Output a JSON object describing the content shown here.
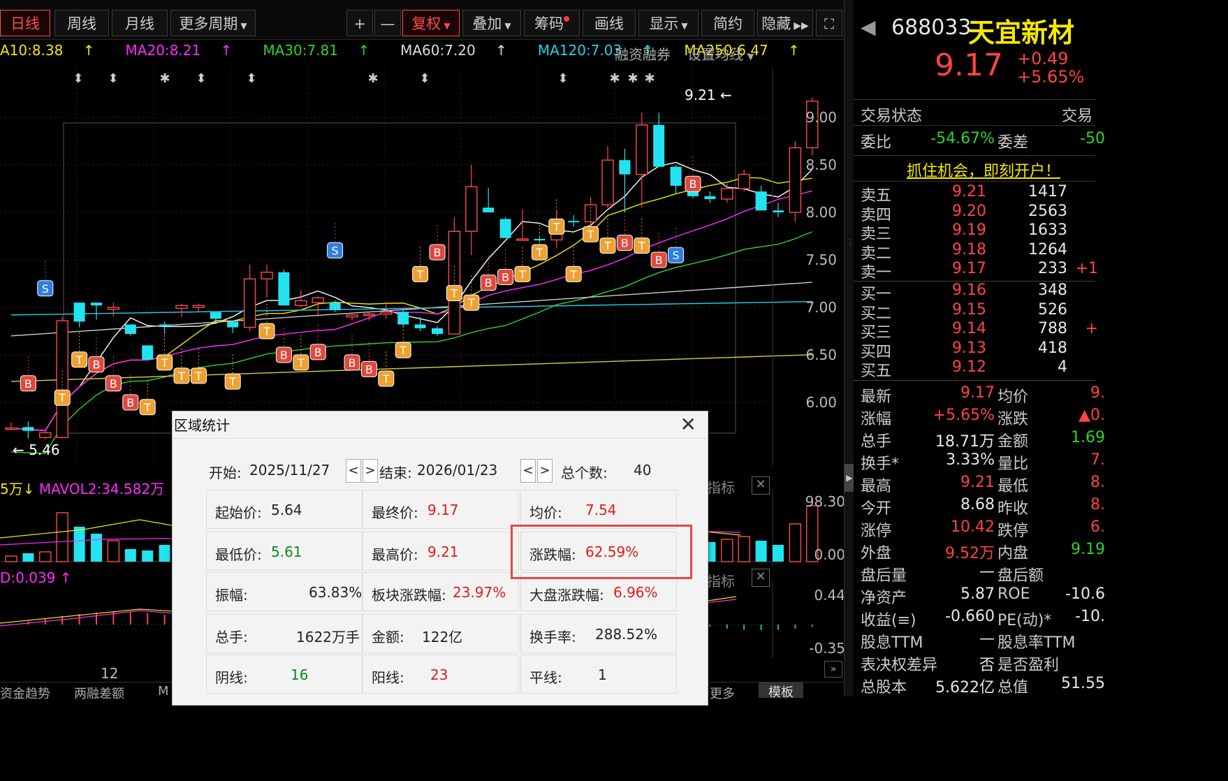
{
  "toolbar": {
    "periods": [
      {
        "label": "日线",
        "active": true
      },
      {
        "label": "周线",
        "active": false
      },
      {
        "label": "月线",
        "active": false
      },
      {
        "label": "更多周期",
        "active": false
      }
    ],
    "right_buttons": [
      "+",
      "—",
      "复权",
      "叠加",
      "筹码",
      "画线",
      "显示",
      "简约",
      "隐藏"
    ]
  },
  "ma_line": [
    {
      "text": "A10:8.38",
      "color": "#f4e800"
    },
    {
      "text": "MA20:8.21",
      "color": "#ff2bff"
    },
    {
      "text": "MA30:7.81",
      "color": "#2bd42b"
    },
    {
      "text": "MA60:7.20",
      "color": "#dddddd"
    },
    {
      "text": "MA120:7.03",
      "color": "#22d3ee"
    },
    {
      "text": "MA250:6.47",
      "color": "#f4e800"
    }
  ],
  "ma_right": {
    "margin": "融资融券",
    "set": "设置均线"
  },
  "price_axis": [
    "9.00",
    "8.50",
    "8.00",
    "7.50",
    "7.00",
    "6.50",
    "6.00"
  ],
  "price_labels": {
    "high": "9.21",
    "low": "5.46"
  },
  "volume_line": {
    "left": "5万",
    "mavol2": "MAVOL2:34.582万"
  },
  "volume_axis": [
    "98.30",
    "0.00"
  ],
  "macd_line": {
    "left": "D:0.039"
  },
  "macd_axis": [
    "0.44",
    "-0.35"
  ],
  "indicator_label": "指标",
  "bottom_tabs": [
    "资金趋势",
    "两融差额",
    "M"
  ],
  "bottom_right_tabs": [
    "更多",
    "模板"
  ],
  "x_label": "12",
  "stock": {
    "code": "688033",
    "name": "天宜新材",
    "price": "9.17",
    "change": "+0.49",
    "change_pct": "+5.65%"
  },
  "trade_status": {
    "label": "交易状态",
    "right": "交易"
  },
  "ratio": {
    "k1": "委比",
    "v1": "-54.67%",
    "k2": "委差",
    "v2": "-50"
  },
  "promo": "抓住机会，即刻开户！",
  "asks": [
    {
      "label": "卖五",
      "price": "9.21",
      "vol": "1417"
    },
    {
      "label": "卖四",
      "price": "9.20",
      "vol": "2563"
    },
    {
      "label": "卖三",
      "price": "9.19",
      "vol": "1633"
    },
    {
      "label": "卖二",
      "price": "9.18",
      "vol": "1264"
    },
    {
      "label": "卖一",
      "price": "9.17",
      "vol": "233",
      "extra": "+1"
    }
  ],
  "bids": [
    {
      "label": "买一",
      "price": "9.16",
      "vol": "348"
    },
    {
      "label": "买二",
      "price": "9.15",
      "vol": "526"
    },
    {
      "label": "买三",
      "price": "9.14",
      "vol": "788",
      "extra": "+"
    },
    {
      "label": "买四",
      "price": "9.13",
      "vol": "418"
    },
    {
      "label": "买五",
      "price": "9.12",
      "vol": "4"
    }
  ],
  "quotes": [
    {
      "k1": "最新",
      "v1": "9.17",
      "c1": "red",
      "k2": "均价",
      "v2": "9."
    },
    {
      "k1": "涨幅",
      "v1": "+5.65%",
      "c1": "red",
      "k2": "涨跌",
      "v2": "▲0."
    },
    {
      "k1": "总手",
      "v1": "18.71万",
      "c1": "white",
      "k2": "金额",
      "v2": "1.69"
    },
    {
      "k1": "换手*",
      "v1": "3.33%",
      "c1": "white",
      "k2": "量比",
      "v2": "7."
    },
    {
      "k1": "最高",
      "v1": "9.21",
      "c1": "red",
      "k2": "最低",
      "v2": "8."
    },
    {
      "k1": "今开",
      "v1": "8.68",
      "c1": "white",
      "k2": "昨收",
      "v2": "8."
    },
    {
      "k1": "涨停",
      "v1": "10.42",
      "c1": "red",
      "k2": "跌停",
      "v2": "6."
    },
    {
      "k1": "外盘",
      "v1": "9.52万",
      "c1": "red",
      "k2": "内盘",
      "v2": "9.19"
    },
    {
      "k1": "盘后量",
      "v1": "—",
      "c1": "white",
      "k2": "盘后额",
      "v2": ""
    },
    {
      "k1": "净资产",
      "v1": "5.87",
      "c1": "white",
      "k2": "ROE",
      "v2": "-10.6"
    },
    {
      "k1": "收益(≡)",
      "v1": "-0.660",
      "c1": "white",
      "k2": "PE(动)*",
      "v2": "-10."
    },
    {
      "k1": "股息TTM",
      "v1": "—",
      "c1": "white",
      "k2": "股息率TTM",
      "v2": ""
    },
    {
      "k1": "表决权差异",
      "v1": "否",
      "c1": "white",
      "k2": "是否盈利",
      "v2": ""
    },
    {
      "k1": "总股本",
      "v1": "5.622亿",
      "c1": "white",
      "k2": "总值",
      "v2": "51.55"
    }
  ],
  "dialog": {
    "title": "区域统计",
    "start_label": "开始:",
    "start_date": "2025/11/27",
    "end_label": "结束:",
    "end_date": "2026/01/23",
    "count_label": "总个数:",
    "count": "40",
    "rows": [
      [
        {
          "k": "起始价:",
          "v": "5.64",
          "c": "dark"
        },
        {
          "k": "最终价:",
          "v": "9.17",
          "c": "red"
        },
        {
          "k": "均价:",
          "v": "7.54",
          "c": "red"
        }
      ],
      [
        {
          "k": "最低价:",
          "v": "5.61",
          "c": "green"
        },
        {
          "k": "最高价:",
          "v": "9.21",
          "c": "red"
        },
        {
          "k": "涨跌幅:",
          "v": "62.59%",
          "c": "red"
        }
      ],
      [
        {
          "k": "振幅:",
          "v": "63.83%",
          "c": "dark"
        },
        {
          "k": "板块涨跌幅:",
          "v": "23.97%",
          "c": "red"
        },
        {
          "k": "大盘涨跌幅:",
          "v": "6.96%",
          "c": "red"
        }
      ],
      [
        {
          "k": "总手:",
          "v": "1622万手",
          "c": "dark"
        },
        {
          "k": "金额:",
          "v": "122亿",
          "c": "dark"
        },
        {
          "k": "换手率:",
          "v": "288.52%",
          "c": "dark"
        }
      ],
      [
        {
          "k": "阴线:",
          "v": "16",
          "c": "green"
        },
        {
          "k": "阳线:",
          "v": "23",
          "c": "red"
        },
        {
          "k": "平线:",
          "v": "1",
          "c": "dark"
        }
      ]
    ]
  },
  "candles": [
    [
      5.73,
      5.79,
      5.72,
      5.73
    ],
    [
      5.74,
      5.8,
      5.62,
      5.7
    ],
    [
      5.63,
      5.72,
      5.61,
      5.68
    ],
    [
      5.63,
      6.9,
      5.62,
      6.86
    ],
    [
      7.05,
      7.0,
      6.79,
      6.85
    ],
    [
      7.05,
      7.05,
      6.87,
      7.02
    ],
    [
      6.98,
      7.05,
      6.9,
      7.0
    ],
    [
      6.82,
      6.81,
      6.7,
      6.72
    ],
    [
      6.6,
      6.59,
      6.5,
      6.45
    ],
    [
      6.82,
      6.85,
      6.72,
      6.8
    ],
    [
      6.99,
      7.04,
      6.9,
      7.02
    ],
    [
      7.0,
      7.04,
      6.95,
      7.02
    ],
    [
      6.95,
      6.94,
      6.85,
      6.88
    ],
    [
      6.85,
      6.82,
      6.73,
      6.79
    ],
    [
      6.79,
      7.45,
      6.75,
      7.3
    ],
    [
      7.3,
      7.45,
      7.1,
      7.37
    ],
    [
      7.37,
      7.4,
      7.15,
      7.02
    ],
    [
      7.02,
      7.18,
      7.0,
      7.07
    ],
    [
      7.05,
      7.12,
      6.9,
      7.1
    ],
    [
      7.05,
      7.07,
      6.95,
      6.97
    ],
    [
      6.9,
      6.94,
      6.86,
      6.92
    ],
    [
      6.92,
      6.96,
      6.86,
      6.93
    ],
    [
      6.93,
      7.06,
      6.88,
      6.95
    ],
    [
      6.95,
      6.98,
      6.8,
      6.82
    ],
    [
      6.82,
      6.9,
      6.75,
      6.78
    ],
    [
      6.78,
      6.8,
      6.7,
      6.72
    ],
    [
      6.72,
      7.95,
      6.72,
      7.8
    ],
    [
      7.8,
      8.5,
      7.55,
      8.27
    ],
    [
      8.05,
      8.26,
      8.0,
      8.0
    ],
    [
      7.93,
      7.95,
      7.8,
      7.73
    ],
    [
      7.72,
      8.03,
      7.7,
      7.72
    ],
    [
      7.72,
      7.74,
      7.69,
      7.71
    ],
    [
      7.71,
      8.02,
      7.62,
      7.91
    ],
    [
      7.91,
      7.97,
      7.85,
      7.9
    ],
    [
      7.9,
      8.16,
      7.85,
      8.08
    ],
    [
      8.08,
      8.7,
      8.05,
      8.55
    ],
    [
      8.55,
      8.67,
      8.0,
      8.4
    ],
    [
      8.4,
      9.05,
      8.05,
      8.92
    ],
    [
      8.92,
      9.05,
      8.48,
      8.48
    ],
    [
      8.48,
      8.5,
      8.2,
      8.28
    ],
    [
      8.28,
      8.35,
      8.15,
      8.17
    ],
    [
      8.17,
      8.22,
      8.1,
      8.14
    ],
    [
      8.14,
      8.3,
      8.1,
      8.25
    ],
    [
      8.25,
      8.45,
      8.22,
      8.4
    ],
    [
      8.22,
      8.28,
      8.08,
      8.02
    ],
    [
      8.02,
      8.1,
      7.95,
      8.0
    ],
    [
      8.0,
      8.75,
      7.9,
      8.68
    ],
    [
      8.68,
      9.21,
      8.6,
      9.17
    ]
  ],
  "markers": [
    {
      "i": 1,
      "t": "B",
      "p": 6.2
    },
    {
      "i": 2,
      "t": "S",
      "p": 7.2
    },
    {
      "i": 3,
      "t": "T",
      "p": 6.05
    },
    {
      "i": 4,
      "t": "T",
      "p": 6.45
    },
    {
      "i": 5,
      "t": "B",
      "p": 6.4
    },
    {
      "i": 6,
      "t": "B",
      "p": 6.2
    },
    {
      "i": 7,
      "t": "B",
      "p": 6.0
    },
    {
      "i": 8,
      "t": "T",
      "p": 5.95
    },
    {
      "i": 9,
      "t": "T",
      "p": 6.42
    },
    {
      "i": 10,
      "t": "T",
      "p": 6.28
    },
    {
      "i": 11,
      "t": "T",
      "p": 6.28
    },
    {
      "i": 13,
      "t": "T",
      "p": 6.22
    },
    {
      "i": 15,
      "t": "T",
      "p": 6.75
    },
    {
      "i": 16,
      "t": "B",
      "p": 6.5
    },
    {
      "i": 17,
      "t": "T",
      "p": 6.42
    },
    {
      "i": 18,
      "t": "B",
      "p": 6.53
    },
    {
      "i": 19,
      "t": "S",
      "p": 7.6
    },
    {
      "i": 20,
      "t": "B",
      "p": 6.42
    },
    {
      "i": 21,
      "t": "B",
      "p": 6.35
    },
    {
      "i": 22,
      "t": "T",
      "p": 6.25
    },
    {
      "i": 23,
      "t": "T",
      "p": 6.55
    },
    {
      "i": 24,
      "t": "T",
      "p": 7.35
    },
    {
      "i": 25,
      "t": "B",
      "p": 7.58
    },
    {
      "i": 26,
      "t": "T",
      "p": 7.15
    },
    {
      "i": 27,
      "t": "T",
      "p": 7.05
    },
    {
      "i": 28,
      "t": "B",
      "p": 7.26
    },
    {
      "i": 29,
      "t": "B",
      "p": 7.32
    },
    {
      "i": 30,
      "t": "T",
      "p": 7.35
    },
    {
      "i": 31,
      "t": "T",
      "p": 7.58
    },
    {
      "i": 32,
      "t": "T",
      "p": 7.85
    },
    {
      "i": 33,
      "t": "T",
      "p": 7.35
    },
    {
      "i": 34,
      "t": "T",
      "p": 7.77
    },
    {
      "i": 35,
      "t": "T",
      "p": 7.65
    },
    {
      "i": 36,
      "t": "B",
      "p": 7.68
    },
    {
      "i": 37,
      "t": "T",
      "p": 7.65
    },
    {
      "i": 38,
      "t": "B",
      "p": 7.5
    },
    {
      "i": 39,
      "t": "S",
      "p": 7.55
    },
    {
      "i": 40,
      "t": "B",
      "p": 8.3
    }
  ]
}
